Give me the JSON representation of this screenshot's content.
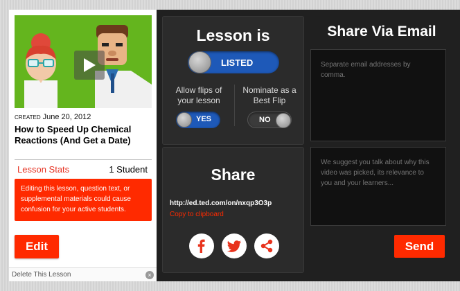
{
  "lesson": {
    "created_label": "Created",
    "created_date": "June 20, 2012",
    "title": "How to Speed Up Chemical Reactions (And Get a Date)",
    "stats_label": "Lesson Stats",
    "stats_count": "1 Student",
    "warning": "Editing this lesson, question text, or supplemental materials could cause confusion for your active students.",
    "edit_label": "Edit",
    "delete_label": "Delete This Lesson",
    "thumbnail_icon": "play-icon"
  },
  "status": {
    "heading": "Lesson is",
    "listed_label": "LISTED",
    "flips_label": "Allow flips of your lesson",
    "flips_value": "YES",
    "nominate_label": "Nominate as a Best Flip",
    "nominate_value": "NO"
  },
  "share": {
    "heading": "Share",
    "url": "http://ed.ted.com/on/nxqp3O3p",
    "copy_label": "Copy to clipboard",
    "icons": [
      "facebook-icon",
      "twitter-icon",
      "share-icon"
    ]
  },
  "email": {
    "heading": "Share Via Email",
    "addresses_placeholder": "Separate email addresses by comma.",
    "message_placeholder": "We suggest you talk about why this video was picked, its relevance to you and your learners...",
    "send_label": "Send"
  },
  "colors": {
    "accent_red": "#ff2a00",
    "toggle_blue": "#1e59b8",
    "panel_dark": "#202020"
  }
}
